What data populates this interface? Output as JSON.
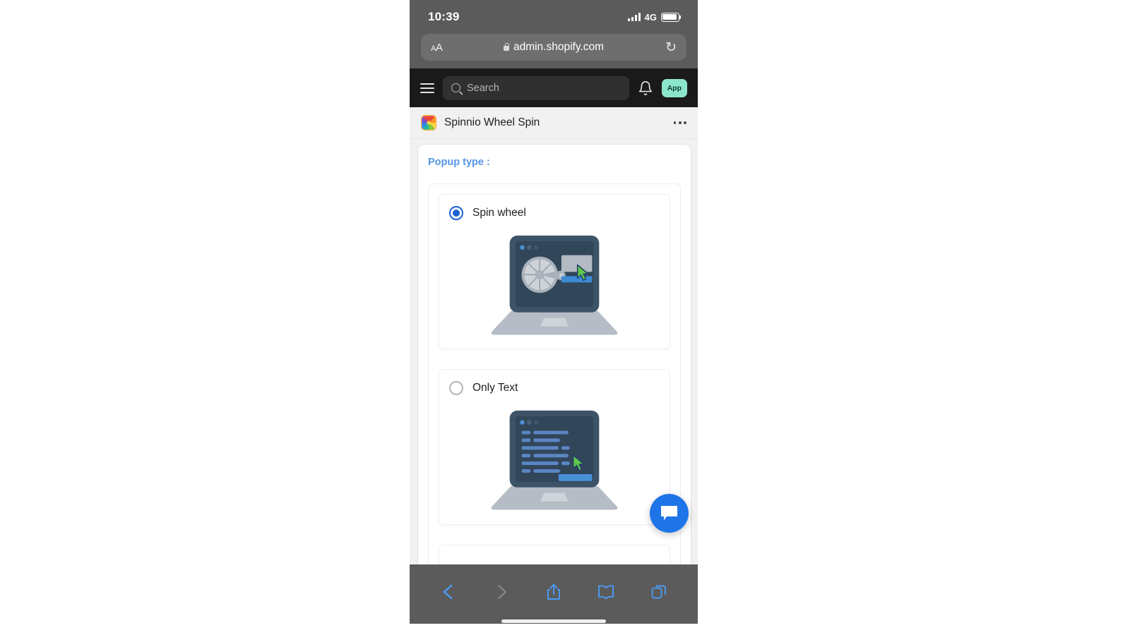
{
  "status_bar": {
    "time": "10:39",
    "network": "4G",
    "signal_icon": "signal-bars-icon",
    "battery_icon": "battery-icon"
  },
  "browser": {
    "text_size_button": "AA",
    "lock_icon": "lock-icon",
    "url": "admin.shopify.com",
    "reload_icon": "↻",
    "toolbar": {
      "back": "‹",
      "forward": "›",
      "share": "share-icon",
      "bookmarks": "book-icon",
      "tabs": "tabs-icon"
    }
  },
  "shopify_nav": {
    "menu_icon": "hamburger-menu-icon",
    "search": {
      "placeholder": "Search",
      "icon": "search-icon"
    },
    "notifications_icon": "bell-icon",
    "account_badge": "App"
  },
  "app_header": {
    "icon": "spinnio-app-icon",
    "title": "Spinnio Wheel Spin",
    "more_icon": "more-options-icon"
  },
  "main": {
    "section_label": "Popup type :",
    "options": [
      {
        "label": "Spin wheel",
        "selected": true,
        "illustration": "laptop-spin-wheel-illustration"
      },
      {
        "label": "Only Text",
        "selected": false,
        "illustration": "laptop-only-text-illustration"
      }
    ]
  },
  "chat_widget": {
    "icon": "chat-bubble-icon",
    "color": "#1f75e8"
  },
  "colors": {
    "accent_blue": "#5596e6",
    "radio_selected": "#1c62d4",
    "nav_dark": "#1a1a1a",
    "app_badge_green": "#8ce6cd",
    "chrome_gray": "#5b5b5b",
    "toolbar_blue": "#4a9bf5"
  }
}
